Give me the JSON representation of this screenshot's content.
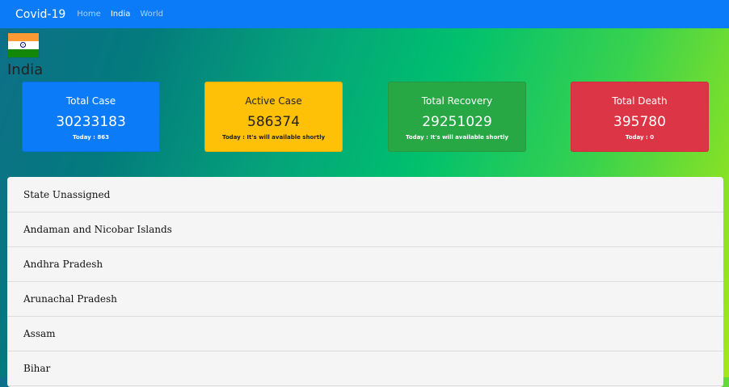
{
  "navbar": {
    "brand": "Covid-19",
    "links": [
      {
        "label": "Home",
        "active": false
      },
      {
        "label": "India",
        "active": true
      },
      {
        "label": "World",
        "active": false
      }
    ],
    "bg_color": "#0b7bf7"
  },
  "country": {
    "flag_icon": "india-flag-icon",
    "name": "India"
  },
  "cards": [
    {
      "title": "Total Case",
      "value": "30233183",
      "today": "Today : 863",
      "color": "#0b7bf7"
    },
    {
      "title": "Active Case",
      "value": "586374",
      "today": "Today : It's will available shortly",
      "color": "#ffc107"
    },
    {
      "title": "Total Recovery",
      "value": "29251029",
      "today": "Today : It's will available shortly",
      "color": "#28a745"
    },
    {
      "title": "Total Death",
      "value": "395780",
      "today": "Today : 0",
      "color": "#dc3545"
    }
  ],
  "states": [
    "State Unassigned",
    "Andaman and Nicobar Islands",
    "Andhra Pradesh",
    "Arunachal Pradesh",
    "Assam",
    "Bihar"
  ]
}
